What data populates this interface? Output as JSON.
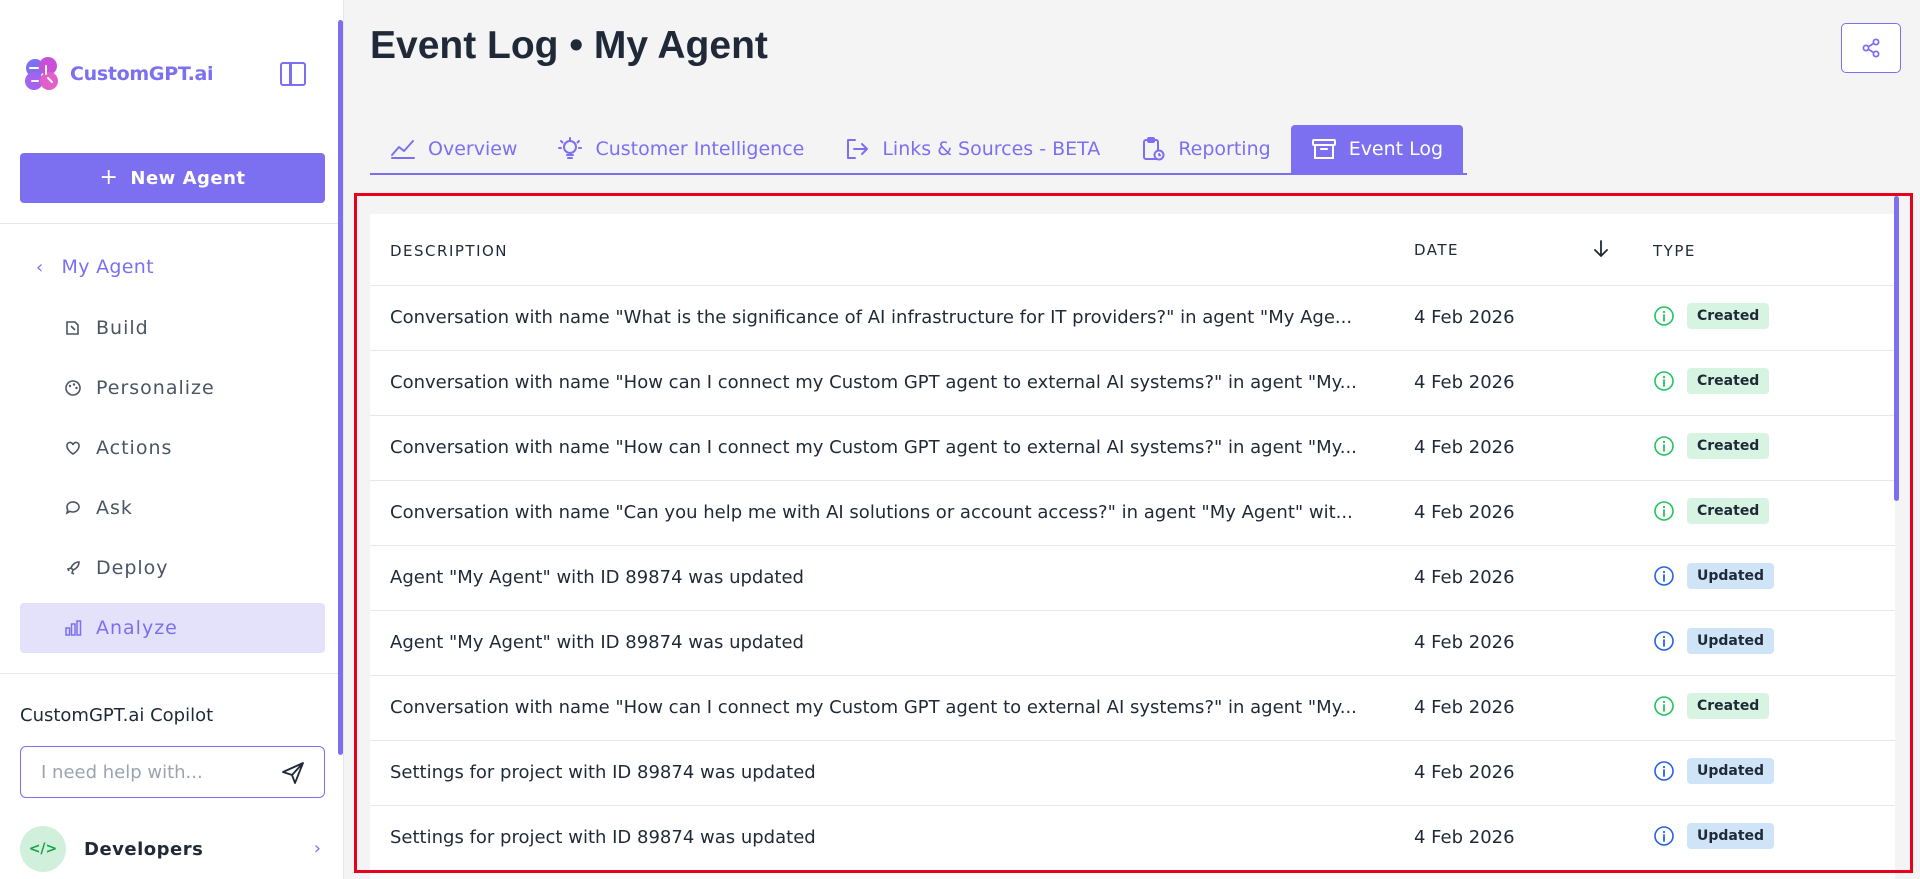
{
  "brand": {
    "name": "CustomGPT.ai"
  },
  "sidebar": {
    "new_agent_label": "New Agent",
    "back_label": "My Agent",
    "items": [
      {
        "label": "Build",
        "icon": "build-icon"
      },
      {
        "label": "Personalize",
        "icon": "palette-icon"
      },
      {
        "label": "Actions",
        "icon": "actions-icon"
      },
      {
        "label": "Ask",
        "icon": "chat-bubble-icon"
      },
      {
        "label": "Deploy",
        "icon": "rocket-icon"
      },
      {
        "label": "Analyze",
        "icon": "bar-chart-icon",
        "active": true
      }
    ],
    "copilot_title": "CustomGPT.ai Copilot",
    "copilot_placeholder": "I need help with...",
    "developers_label": "Developers"
  },
  "header": {
    "title": "Event Log • My Agent"
  },
  "tabs": [
    {
      "label": "Overview",
      "icon": "line-chart-icon"
    },
    {
      "label": "Customer Intelligence",
      "icon": "lightbulb-icon"
    },
    {
      "label": "Links & Sources - BETA",
      "icon": "exit-icon"
    },
    {
      "label": "Reporting",
      "icon": "clipboard-icon"
    },
    {
      "label": "Event Log",
      "icon": "archive-icon",
      "active": true
    }
  ],
  "table": {
    "columns": {
      "description": "DESCRIPTION",
      "date": "DATE",
      "type": "TYPE"
    },
    "rows": [
      {
        "description": "Conversation with name \"What is the significance of AI infrastructure for IT providers?\" in agent \"My Age...",
        "date": "4 Feb 2026",
        "type": "Created"
      },
      {
        "description": "Conversation with name \"How can I connect my Custom GPT agent to external AI systems?\" in agent \"My...",
        "date": "4 Feb 2026",
        "type": "Created"
      },
      {
        "description": "Conversation with name \"How can I connect my Custom GPT agent to external AI systems?\" in agent \"My...",
        "date": "4 Feb 2026",
        "type": "Created"
      },
      {
        "description": "Conversation with name \"Can you help me with AI solutions or account access?\" in agent \"My Agent\" wit...",
        "date": "4 Feb 2026",
        "type": "Created"
      },
      {
        "description": "Agent \"My Agent\" with ID 89874 was updated",
        "date": "4 Feb 2026",
        "type": "Updated"
      },
      {
        "description": "Agent \"My Agent\" with ID 89874 was updated",
        "date": "4 Feb 2026",
        "type": "Updated"
      },
      {
        "description": "Conversation with name \"How can I connect my Custom GPT agent to external AI systems?\" in agent \"My...",
        "date": "4 Feb 2026",
        "type": "Created"
      },
      {
        "description": "Settings for project with ID 89874 was updated",
        "date": "4 Feb 2026",
        "type": "Updated"
      },
      {
        "description": "Settings for project with ID 89874 was updated",
        "date": "4 Feb 2026",
        "type": "Updated"
      }
    ]
  },
  "colors": {
    "accent": "#7c6ff0",
    "created_bg": "#d7f3e2",
    "created_icon": "#22c55e",
    "updated_bg": "#cfe4f7",
    "updated_icon": "#2563eb",
    "frame": "#e8001c"
  }
}
